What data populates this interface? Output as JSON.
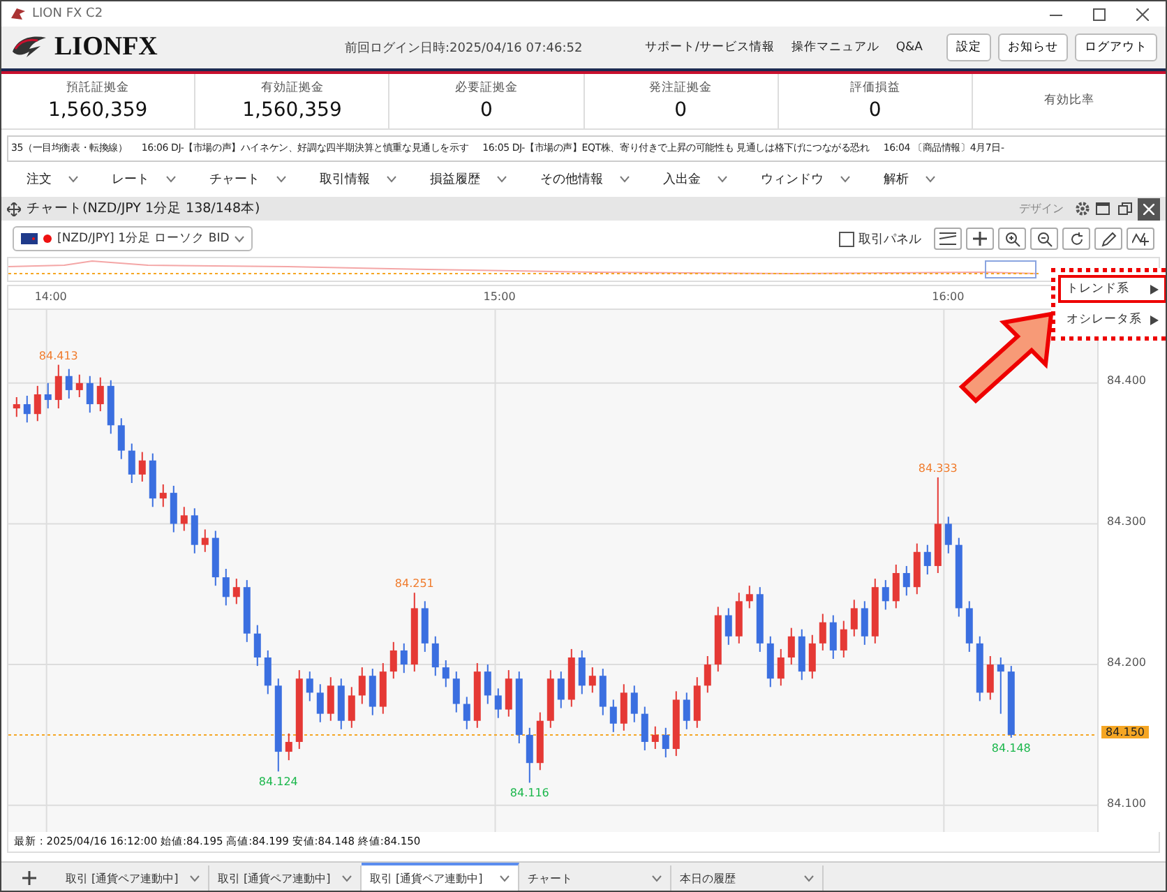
{
  "window": {
    "title": "LION FX C2"
  },
  "header": {
    "logo": "LIONFX",
    "last_login": "前回ログイン日時:2025/04/16 07:46:52",
    "links": [
      "サポート/サービス情報",
      "操作マニュアル",
      "Q&A"
    ],
    "buttons": [
      "設定",
      "お知らせ",
      "ログアウト"
    ]
  },
  "stats": [
    {
      "label": "預託証拠金",
      "value": "1,560,359"
    },
    {
      "label": "有効証拠金",
      "value": "1,560,359"
    },
    {
      "label": "必要証拠金",
      "value": "0"
    },
    {
      "label": "発注証拠金",
      "value": "0"
    },
    {
      "label": "評価損益",
      "value": "0"
    },
    {
      "label": "有効比率"
    }
  ],
  "ticker": [
    {
      "text": "35（一目均衡表・転換線）"
    },
    {
      "time": "16:06",
      "text": "DJ-【市場の声】ハイネケン、好調な四半期決算と慎重な見通しを示す"
    },
    {
      "time": "16:05",
      "text": "DJ-【市場の声】EQT株、寄り付きで上昇の可能性も 見通しは格下げにつながる恐れ"
    },
    {
      "time": "16:04",
      "text": "〔商品情報〕4月7日-"
    }
  ],
  "menu": [
    "注文",
    "レート",
    "チャート",
    "取引情報",
    "損益履歴",
    "その他情報",
    "入出金",
    "ウィンドウ",
    "解析"
  ],
  "chart_panel": {
    "title": "チャート(NZD/JPY 1分足 138/148本)",
    "design_label": "デザイン",
    "symbol_select": "[NZD/JPY] 1分足 ローソク BID",
    "trade_panel": {
      "label": "取引パネル",
      "checked": false
    },
    "annotations": [
      {
        "kind": "high",
        "text": "84.413"
      },
      {
        "kind": "low",
        "text": "84.124"
      },
      {
        "kind": "high",
        "text": "84.251"
      },
      {
        "kind": "low",
        "text": "84.116"
      },
      {
        "kind": "high",
        "text": "84.333"
      },
      {
        "kind": "low",
        "text": "84.148"
      }
    ],
    "chart_data": {
      "type": "candlestick",
      "x": [
        836,
        837.4,
        838.8,
        840.2,
        841.6,
        843,
        844.4,
        845.8,
        847.2,
        848.6,
        850,
        851.4,
        852.8,
        854.2,
        855.6,
        857,
        858.4,
        859.8,
        861.2,
        862.6,
        864,
        865.4,
        866.8,
        868.2,
        869.6,
        871,
        872.4,
        873.8,
        875.2,
        876.6,
        878,
        879.4,
        880.8,
        882.2,
        883.6,
        885,
        886.4,
        887.8,
        889.2,
        890.6,
        892,
        893.4,
        894.8,
        896.2,
        897.6,
        899,
        900.4,
        901.8,
        903.2,
        904.6,
        906,
        907.4,
        908.8,
        910.2,
        911.6,
        913,
        914.4,
        915.8,
        917.2,
        918.6,
        920,
        921.4,
        922.8,
        924.2,
        925.6,
        927,
        928.4,
        929.8,
        931.2,
        932.6,
        934,
        935.4,
        936.8,
        938.2,
        939.6,
        941,
        942.4,
        943.8,
        945.2,
        946.6,
        948,
        949.4,
        950.8,
        952.2,
        953.6,
        955,
        956.4,
        957.8,
        959.2,
        960.6,
        962,
        963.4,
        964.8,
        966.2,
        967.6,
        969
      ],
      "xlim": [
        834.9,
        980.5
      ],
      "grid": true,
      "ref_lines": [
        {
          "axis": "y",
          "value": 84.15,
          "label": "84.150",
          "color": "#f5a623"
        }
      ],
      "ylim": [
        84.081,
        84.452
      ],
      "ohlc": [
        [
          84.382,
          84.39,
          84.376,
          84.385
        ],
        [
          84.385,
          84.391,
          84.372,
          84.378
        ],
        [
          84.378,
          84.398,
          84.373,
          84.392
        ],
        [
          84.392,
          84.4,
          84.382,
          84.388
        ],
        [
          84.388,
          84.413,
          84.382,
          84.405
        ],
        [
          84.405,
          84.41,
          84.389,
          84.395
        ],
        [
          84.395,
          84.406,
          84.39,
          84.4
        ],
        [
          84.4,
          84.405,
          84.379,
          84.385
        ],
        [
          84.385,
          84.404,
          84.38,
          84.398
        ],
        [
          84.398,
          84.402,
          84.364,
          84.37
        ],
        [
          84.37,
          84.375,
          84.346,
          84.352
        ],
        [
          84.352,
          84.357,
          84.329,
          84.335
        ],
        [
          84.335,
          84.351,
          84.33,
          84.345
        ],
        [
          84.345,
          84.35,
          84.312,
          84.318
        ],
        [
          84.318,
          84.328,
          84.312,
          84.322
        ],
        [
          84.322,
          84.327,
          84.294,
          84.3
        ],
        [
          84.3,
          84.312,
          84.295,
          84.306
        ],
        [
          84.306,
          84.311,
          84.279,
          84.285
        ],
        [
          84.285,
          84.296,
          84.28,
          84.29
        ],
        [
          84.29,
          84.295,
          84.256,
          84.262
        ],
        [
          84.262,
          84.268,
          84.242,
          84.248
        ],
        [
          84.248,
          84.261,
          84.243,
          84.255
        ],
        [
          84.255,
          84.26,
          84.216,
          84.222
        ],
        [
          84.222,
          84.228,
          84.199,
          84.205
        ],
        [
          84.205,
          84.21,
          84.179,
          84.185
        ],
        [
          84.185,
          84.19,
          84.124,
          84.138
        ],
        [
          84.138,
          84.151,
          84.132,
          84.145
        ],
        [
          84.145,
          84.196,
          84.14,
          84.19
        ],
        [
          84.19,
          84.195,
          84.174,
          84.18
        ],
        [
          84.18,
          84.186,
          84.159,
          84.165
        ],
        [
          84.165,
          84.191,
          84.16,
          84.185
        ],
        [
          84.185,
          84.19,
          84.154,
          84.16
        ],
        [
          84.16,
          84.184,
          84.155,
          84.178
        ],
        [
          84.178,
          84.198,
          84.172,
          84.192
        ],
        [
          84.192,
          84.197,
          84.164,
          84.17
        ],
        [
          84.17,
          84.201,
          84.165,
          84.195
        ],
        [
          84.195,
          84.216,
          84.19,
          84.21
        ],
        [
          84.21,
          84.215,
          84.194,
          84.2
        ],
        [
          84.2,
          84.251,
          84.195,
          84.24
        ],
        [
          84.24,
          84.245,
          84.209,
          84.215
        ],
        [
          84.215,
          84.22,
          84.192,
          84.198
        ],
        [
          84.198,
          84.203,
          84.184,
          84.19
        ],
        [
          84.19,
          84.195,
          84.166,
          84.172
        ],
        [
          84.172,
          84.177,
          84.154,
          84.16
        ],
        [
          84.16,
          84.201,
          84.155,
          84.195
        ],
        [
          84.195,
          84.2,
          84.172,
          84.178
        ],
        [
          84.178,
          84.183,
          84.162,
          84.168
        ],
        [
          84.168,
          84.196,
          84.163,
          84.19
        ],
        [
          84.19,
          84.195,
          84.144,
          84.15
        ],
        [
          84.15,
          84.155,
          84.116,
          84.13
        ],
        [
          84.13,
          84.166,
          84.125,
          84.16
        ],
        [
          84.16,
          84.196,
          84.155,
          84.19
        ],
        [
          84.19,
          84.195,
          84.169,
          84.175
        ],
        [
          84.175,
          84.211,
          84.17,
          84.205
        ],
        [
          84.205,
          84.21,
          84.179,
          84.185
        ],
        [
          84.185,
          84.198,
          84.18,
          84.192
        ],
        [
          84.192,
          84.197,
          84.164,
          84.17
        ],
        [
          84.17,
          84.175,
          84.152,
          84.158
        ],
        [
          84.158,
          84.186,
          84.153,
          84.18
        ],
        [
          84.18,
          84.185,
          84.159,
          84.165
        ],
        [
          84.165,
          84.17,
          84.139,
          84.145
        ],
        [
          84.145,
          84.156,
          84.14,
          84.15
        ],
        [
          84.15,
          84.155,
          84.134,
          84.14
        ],
        [
          84.14,
          84.181,
          84.135,
          84.175
        ],
        [
          84.175,
          84.18,
          84.154,
          84.16
        ],
        [
          84.16,
          84.191,
          84.155,
          84.185
        ],
        [
          84.185,
          84.206,
          84.18,
          84.2
        ],
        [
          84.2,
          84.241,
          84.195,
          84.235
        ],
        [
          84.235,
          84.24,
          84.214,
          84.22
        ],
        [
          84.22,
          84.251,
          84.215,
          84.245
        ],
        [
          84.245,
          84.256,
          84.24,
          84.25
        ],
        [
          84.25,
          84.255,
          84.209,
          84.215
        ],
        [
          84.215,
          84.22,
          84.184,
          84.19
        ],
        [
          84.19,
          84.211,
          84.185,
          84.205
        ],
        [
          84.205,
          84.226,
          84.2,
          84.22
        ],
        [
          84.22,
          84.225,
          84.189,
          84.195
        ],
        [
          84.195,
          84.221,
          84.19,
          84.215
        ],
        [
          84.215,
          84.236,
          84.21,
          84.23
        ],
        [
          84.23,
          84.235,
          84.204,
          84.21
        ],
        [
          84.21,
          84.231,
          84.205,
          84.225
        ],
        [
          84.225,
          84.246,
          84.22,
          84.24
        ],
        [
          84.24,
          84.245,
          84.214,
          84.22
        ],
        [
          84.22,
          84.261,
          84.215,
          84.255
        ],
        [
          84.255,
          84.26,
          84.239,
          84.245
        ],
        [
          84.245,
          84.271,
          84.24,
          84.265
        ],
        [
          84.265,
          84.27,
          84.249,
          84.255
        ],
        [
          84.255,
          84.286,
          84.25,
          84.28
        ],
        [
          84.28,
          84.285,
          84.264,
          84.27
        ],
        [
          84.27,
          84.333,
          84.265,
          84.3
        ],
        [
          84.3,
          84.305,
          84.279,
          84.285
        ],
        [
          84.285,
          84.29,
          84.234,
          84.24
        ],
        [
          84.24,
          84.245,
          84.209,
          84.215
        ],
        [
          84.215,
          84.22,
          84.174,
          84.18
        ],
        [
          84.18,
          84.206,
          84.175,
          84.2
        ],
        [
          84.2,
          84.205,
          84.165,
          84.195
        ],
        [
          84.195,
          84.199,
          84.148,
          84.15
        ]
      ],
      "xticks": [
        {
          "value": 840,
          "label": "14:00"
        },
        {
          "value": 900,
          "label": "15:00"
        },
        {
          "value": 960,
          "label": "16:00"
        }
      ],
      "yticks": [
        {
          "value": 84.4,
          "label": "84.400"
        },
        {
          "value": 84.3,
          "label": "84.300"
        },
        {
          "value": 84.2,
          "label": "84.200"
        },
        {
          "value": 84.1,
          "label": "84.100"
        }
      ]
    },
    "status": "最新 : 2025/04/16 16:12:00  始値:84.195  高値:84.199  安値:84.148  終値:84.150",
    "indicator_menu": [
      {
        "label": "トレンド系",
        "selected": true
      },
      {
        "label": "オシレータ系",
        "selected": false
      }
    ]
  },
  "bottom_tabs": [
    {
      "label": "取引 [通貨ペア連動中]",
      "selected": false
    },
    {
      "label": "取引 [通貨ペア連動中]",
      "selected": false
    },
    {
      "label": "取引 [通貨ペア連動中]",
      "selected": true
    },
    {
      "label": "チャート",
      "selected": false
    },
    {
      "label": "本日の履歴",
      "selected": false
    }
  ]
}
